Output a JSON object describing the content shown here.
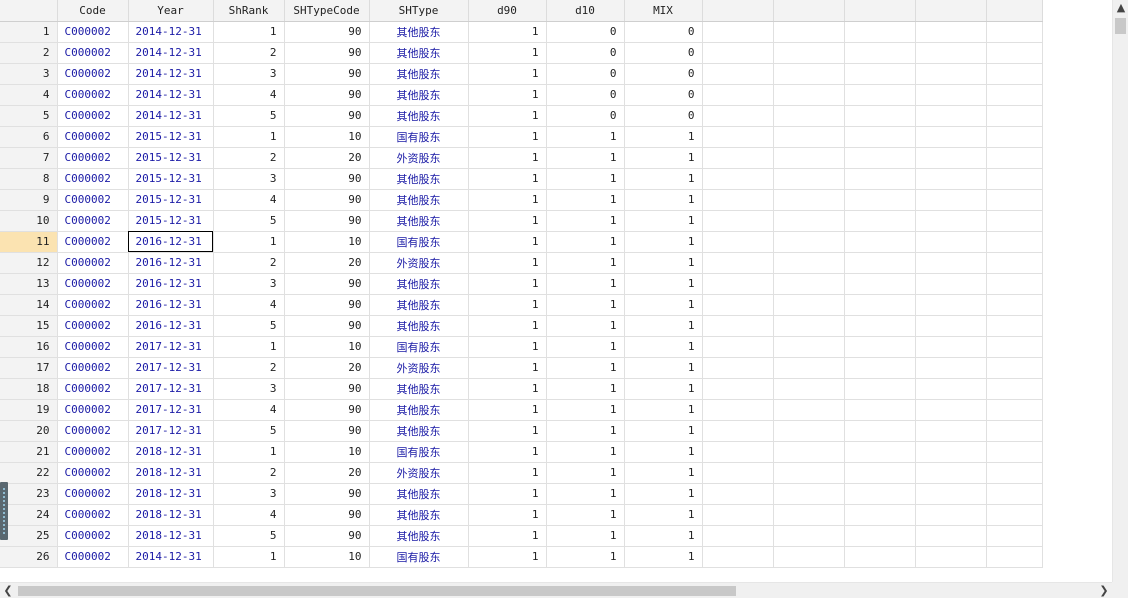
{
  "columns": [
    "Code",
    "Year",
    "ShRank",
    "SHTypeCode",
    "SHType",
    "d90",
    "d10",
    "MIX"
  ],
  "selected_column": "Year",
  "selected_row": "11",
  "rows": [
    [
      "1",
      "C000002",
      "2014-12-31",
      "1",
      "90",
      "其他股东",
      "1",
      "0",
      "0"
    ],
    [
      "2",
      "C000002",
      "2014-12-31",
      "2",
      "90",
      "其他股东",
      "1",
      "0",
      "0"
    ],
    [
      "3",
      "C000002",
      "2014-12-31",
      "3",
      "90",
      "其他股东",
      "1",
      "0",
      "0"
    ],
    [
      "4",
      "C000002",
      "2014-12-31",
      "4",
      "90",
      "其他股东",
      "1",
      "0",
      "0"
    ],
    [
      "5",
      "C000002",
      "2014-12-31",
      "5",
      "90",
      "其他股东",
      "1",
      "0",
      "0"
    ],
    [
      "6",
      "C000002",
      "2015-12-31",
      "1",
      "10",
      "国有股东",
      "1",
      "1",
      "1"
    ],
    [
      "7",
      "C000002",
      "2015-12-31",
      "2",
      "20",
      "外资股东",
      "1",
      "1",
      "1"
    ],
    [
      "8",
      "C000002",
      "2015-12-31",
      "3",
      "90",
      "其他股东",
      "1",
      "1",
      "1"
    ],
    [
      "9",
      "C000002",
      "2015-12-31",
      "4",
      "90",
      "其他股东",
      "1",
      "1",
      "1"
    ],
    [
      "10",
      "C000002",
      "2015-12-31",
      "5",
      "90",
      "其他股东",
      "1",
      "1",
      "1"
    ],
    [
      "11",
      "C000002",
      "2016-12-31",
      "1",
      "10",
      "国有股东",
      "1",
      "1",
      "1"
    ],
    [
      "12",
      "C000002",
      "2016-12-31",
      "2",
      "20",
      "外资股东",
      "1",
      "1",
      "1"
    ],
    [
      "13",
      "C000002",
      "2016-12-31",
      "3",
      "90",
      "其他股东",
      "1",
      "1",
      "1"
    ],
    [
      "14",
      "C000002",
      "2016-12-31",
      "4",
      "90",
      "其他股东",
      "1",
      "1",
      "1"
    ],
    [
      "15",
      "C000002",
      "2016-12-31",
      "5",
      "90",
      "其他股东",
      "1",
      "1",
      "1"
    ],
    [
      "16",
      "C000002",
      "2017-12-31",
      "1",
      "10",
      "国有股东",
      "1",
      "1",
      "1"
    ],
    [
      "17",
      "C000002",
      "2017-12-31",
      "2",
      "20",
      "外资股东",
      "1",
      "1",
      "1"
    ],
    [
      "18",
      "C000002",
      "2017-12-31",
      "3",
      "90",
      "其他股东",
      "1",
      "1",
      "1"
    ],
    [
      "19",
      "C000002",
      "2017-12-31",
      "4",
      "90",
      "其他股东",
      "1",
      "1",
      "1"
    ],
    [
      "20",
      "C000002",
      "2017-12-31",
      "5",
      "90",
      "其他股东",
      "1",
      "1",
      "1"
    ],
    [
      "21",
      "C000002",
      "2018-12-31",
      "1",
      "10",
      "国有股东",
      "1",
      "1",
      "1"
    ],
    [
      "22",
      "C000002",
      "2018-12-31",
      "2",
      "20",
      "外资股东",
      "1",
      "1",
      "1"
    ],
    [
      "23",
      "C000002",
      "2018-12-31",
      "3",
      "90",
      "其他股东",
      "1",
      "1",
      "1"
    ],
    [
      "24",
      "C000002",
      "2018-12-31",
      "4",
      "90",
      "其他股东",
      "1",
      "1",
      "1"
    ],
    [
      "25",
      "C000002",
      "2018-12-31",
      "5",
      "90",
      "其他股东",
      "1",
      "1",
      "1"
    ],
    [
      "26",
      "C000002",
      "2014-12-31",
      "1",
      "10",
      "国有股东",
      "1",
      "1",
      "1"
    ]
  ],
  "icons": {
    "scroll_up": "chevron-up-icon",
    "scroll_right": "chevron-right-icon",
    "scroll_left": "chevron-left-icon"
  },
  "colors": {
    "header_bg": "#f3f3f3",
    "selection_highlight": "#fbe3b1",
    "string_text": "#1a1aa6",
    "number_text": "#222222"
  }
}
